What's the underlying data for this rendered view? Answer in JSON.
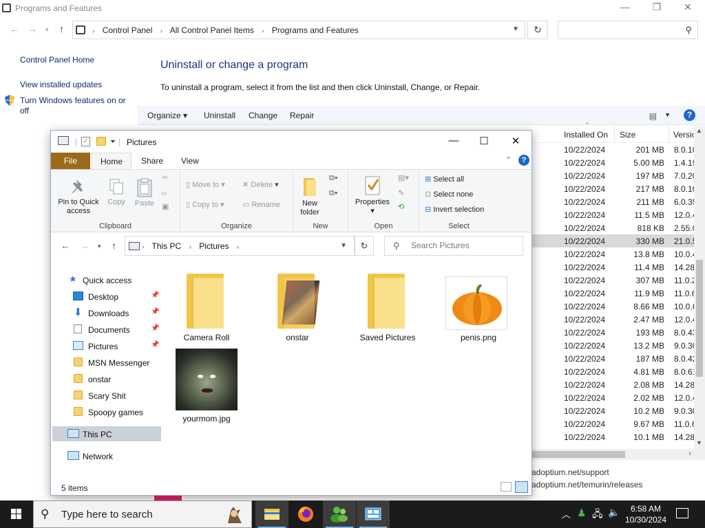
{
  "control_panel": {
    "window_title": "Programs and Features",
    "breadcrumb": [
      "Control Panel",
      "All Control Panel Items",
      "Programs and Features"
    ],
    "left_links": [
      "Control Panel Home",
      "View installed updates",
      "Turn Windows features on or off"
    ],
    "heading": "Uninstall or change a program",
    "subtext": "To uninstall a program, select it from the list and then click Uninstall, Change, or Repair.",
    "toolbar": [
      "Organize ▾",
      "Uninstall",
      "Change",
      "Repair"
    ],
    "columns": [
      "Installed On",
      "Size",
      "Versio"
    ],
    "rows": [
      {
        "date": "10/22/2024",
        "size": "201 MB",
        "version": "8.0.10"
      },
      {
        "date": "10/22/2024",
        "size": "5.00 MB",
        "version": "1.4.19"
      },
      {
        "date": "10/22/2024",
        "size": "197 MB",
        "version": "7.0.20"
      },
      {
        "date": "10/22/2024",
        "size": "217 MB",
        "version": "8.0.10"
      },
      {
        "date": "10/22/2024",
        "size": "211 MB",
        "version": "6.0.35"
      },
      {
        "date": "10/22/2024",
        "size": "11.5 MB",
        "version": "12.0.4"
      },
      {
        "date": "10/22/2024",
        "size": "818 KB",
        "version": "2.55.0"
      },
      {
        "date": "10/22/2024",
        "size": "330 MB",
        "version": "21.0.5",
        "selected": true
      },
      {
        "date": "10/22/2024",
        "size": "13.8 MB",
        "version": "10.0.4"
      },
      {
        "date": "10/22/2024",
        "size": "11.4 MB",
        "version": "14.28"
      },
      {
        "date": "10/22/2024",
        "size": "307 MB",
        "version": "11.0.2"
      },
      {
        "date": "10/22/2024",
        "size": "11.9 MB",
        "version": "11.0.6"
      },
      {
        "date": "10/22/2024",
        "size": "8.66 MB",
        "version": "10.0.6"
      },
      {
        "date": "10/22/2024",
        "size": "2.47 MB",
        "version": "12.0.4"
      },
      {
        "date": "10/22/2024",
        "size": "193 MB",
        "version": "8.0.43"
      },
      {
        "date": "10/22/2024",
        "size": "13.2 MB",
        "version": "9.0.30"
      },
      {
        "date": "10/22/2024",
        "size": "187 MB",
        "version": "8.0.42"
      },
      {
        "date": "10/22/2024",
        "size": "4.81 MB",
        "version": "8.0.61"
      },
      {
        "date": "10/22/2024",
        "size": "2.08 MB",
        "version": "14.28"
      },
      {
        "date": "10/22/2024",
        "size": "2.02 MB",
        "version": "12.0.4"
      },
      {
        "date": "10/22/2024",
        "size": "10.2 MB",
        "version": "9.0.30"
      },
      {
        "date": "10/22/2024",
        "size": "9.67 MB",
        "version": "11.0.6"
      },
      {
        "date": "10/22/2024",
        "size": "10.1 MB",
        "version": "14.28"
      }
    ],
    "support_links": [
      "adoptium.net/support",
      "adoptium.net/temurin/releases"
    ]
  },
  "explorer": {
    "title": "Pictures",
    "ribbon_tabs": [
      "File",
      "Home",
      "Share",
      "View"
    ],
    "clipboard": {
      "pin": "Pin to Quick access",
      "copy": "Copy",
      "paste": "Paste",
      "label": "Clipboard"
    },
    "organize": {
      "move_to": "Move to",
      "copy_to": "Copy to",
      "delete": "Delete",
      "rename": "Rename",
      "label": "Organize"
    },
    "new": {
      "new_folder": "New folder",
      "label": "New"
    },
    "open": {
      "properties": "Properties",
      "label": "Open"
    },
    "select": {
      "select_all": "Select all",
      "select_none": "Select none",
      "invert": "Invert selection",
      "label": "Select"
    },
    "path": [
      "This PC",
      "Pictures"
    ],
    "search_placeholder": "Search Pictures",
    "nav": {
      "quick_access": "Quick access",
      "items": [
        "Desktop",
        "Downloads",
        "Documents",
        "Pictures",
        "MSN Messenger",
        "onstar",
        "Scary Shit",
        "Spoopy games"
      ],
      "this_pc": "This PC",
      "network": "Network"
    },
    "files": [
      "Camera Roll",
      "onstar",
      "Saved Pictures",
      "penis.png",
      "yourmom.jpg"
    ],
    "status": "5 items"
  },
  "taskbar": {
    "search_text": "Type here to search",
    "time": "6:58 AM",
    "date": "10/30/2024"
  }
}
